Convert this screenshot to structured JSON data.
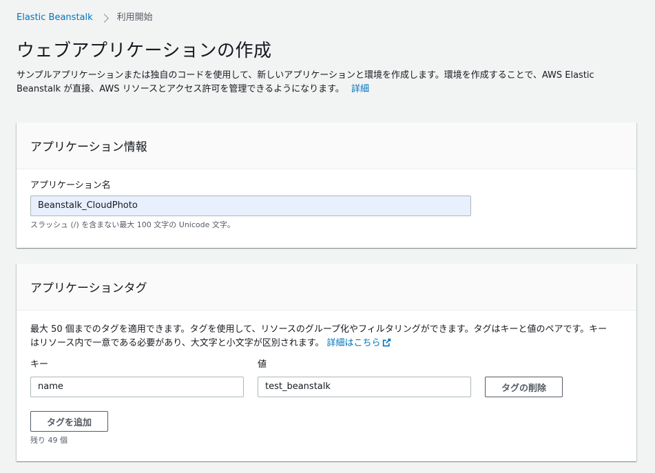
{
  "breadcrumb": {
    "root": "Elastic Beanstalk",
    "current": "利用開始"
  },
  "header": {
    "title": "ウェブアプリケーションの作成",
    "description": "サンプルアプリケーションまたは独自のコードを使用して、新しいアプリケーションと環境を作成します。環境を作成することで、AWS Elastic Beanstalk が直接、AWS リソースとアクセス許可を管理できるようになります。",
    "details_link": "詳細"
  },
  "app_info": {
    "title": "アプリケーション情報",
    "name_label": "アプリケーション名",
    "name_value": "Beanstalk_CloudPhoto",
    "name_hint": "スラッシュ (/) を含まない最大 100 文字の Unicode 文字。"
  },
  "app_tags": {
    "title": "アプリケーションタグ",
    "description": "最大 50 個までのタグを適用できます。タグを使用して、リソースのグループ化やフィルタリングができます。タグはキーと値のペアです。キーはリソース内で一意である必要があり、大文字と小文字が区別されます。",
    "details_link": "詳細はこちら",
    "key_label": "キー",
    "value_label": "値",
    "tags": [
      {
        "key": "name",
        "value": "test_beanstalk"
      }
    ],
    "remove_button": "タグの削除",
    "add_button": "タグを追加",
    "remaining": "残り 49 個"
  },
  "colors": {
    "link": "#0073bb",
    "background": "#f2f3f3",
    "autofill": "#e8f0fe"
  },
  "icons": {
    "breadcrumb_separator": "chevron-right-icon",
    "external_link": "external-link-icon"
  }
}
